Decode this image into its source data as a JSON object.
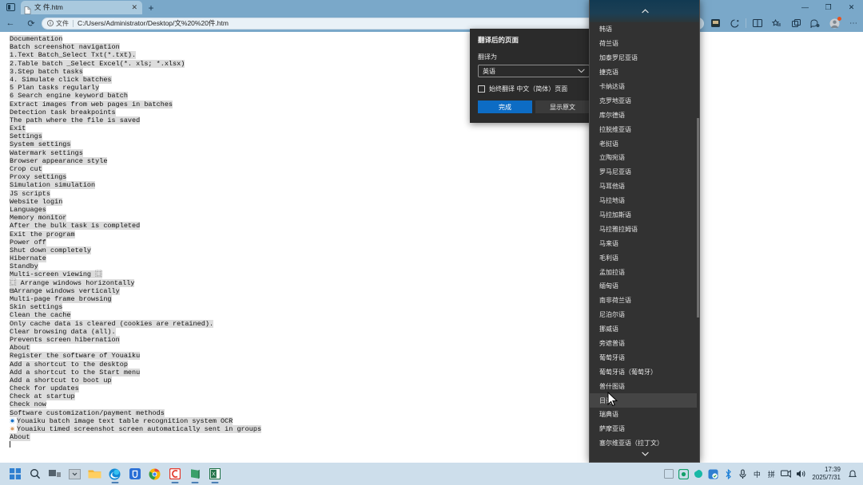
{
  "browser": {
    "tab": {
      "title": "文 件.htm",
      "close_label": "✕",
      "favicon": "page-icon"
    },
    "new_tab_label": "+",
    "window_controls": {
      "minimize": "—",
      "maximize": "❐",
      "close": "✕"
    },
    "nav": {
      "back": "←",
      "reload": "⟳"
    },
    "omnibox": {
      "info_icon": "info-icon",
      "scheme_label": "文件",
      "url": "C:/Users/Administrator/Desktop/文%20%20件.htm"
    },
    "toolbar_icons": [
      "read-aloud-icon",
      "translate-pill-icon",
      "split-screen-icon",
      "browser-essentials-icon",
      "collections-icon",
      "favorites-icon",
      "split-tab-icon",
      "copilot-icon",
      "profile-avatar",
      "settings-more-icon"
    ]
  },
  "document": {
    "lines": [
      "Documentation",
      "Batch screenshot navigation",
      "1.Text Batch_Select Txt(*.txt).",
      "2.Table batch _Select Excel(*. xls; *.xlsx)",
      "3.Step batch tasks",
      "4. Simulate click batches",
      "5 Plan tasks regularly",
      "6 Search engine keyword batch",
      "Extract images from web pages in batches",
      "Detection task breakpoints",
      "The path where the file is saved",
      "Exit",
      "Settings",
      "System settings",
      "Watermark settings",
      "Browser appearance style",
      "Crop cut",
      "Proxy settings",
      "Simulation simulation",
      "JS scripts",
      "Website login",
      "Languages",
      "Memory monitor",
      "After the bulk task is completed",
      "Exit the program",
      "Power off",
      "Shut down completely",
      "Hibernate",
      "Standby",
      "Multi-screen viewing ⿴",
      "⿴ Arrange windows horizontally",
      "⊟Arrange windows vertically",
      "Multi-page frame browsing",
      "Skin settings",
      "Clean the cache",
      "Only cache data is cleared (cookies are retained).",
      "Clear browsing data (all).",
      "Prevents screen hibernation",
      "About",
      "Register the software of Youaiku",
      "Add a shortcut to the desktop",
      "Add a shortcut to the Start menu",
      "Add a shortcut to boot up",
      "Check for updates",
      "Check at startup",
      "Check now",
      "Software customization/payment methods"
    ],
    "icon_lines": [
      {
        "icon": "radio-blue-icon",
        "text": "Youaiku batch image text table recognition system OCR"
      },
      {
        "icon": "radio-tan-icon",
        "text": "Youaiku timed screenshot screen automatically sent in groups"
      }
    ],
    "last_line": "About"
  },
  "translate_dialog": {
    "title": "翻译后的页面",
    "subtitle": "翻译为",
    "selected_language": "英语",
    "dropdown_icon": "chevron-down-icon",
    "always_translate_label": "始终翻译 中文（简体）页面",
    "done_button": "完成",
    "show_original_button": "显示原文"
  },
  "language_menu": {
    "scroll_up_icon": "scroll-up-arrow",
    "scroll_down_icon": "scroll-down-arrow",
    "selected": "日语",
    "items": [
      "韩语",
      "荷兰语",
      "加泰罗尼亚语",
      "捷克语",
      "卡纳达语",
      "克罗地亚语",
      "库尔德语",
      "拉脱维亚语",
      "老挝语",
      "立陶宛语",
      "罗马尼亚语",
      "马耳他语",
      "马拉地语",
      "马拉加斯语",
      "马拉雅拉姆语",
      "马来语",
      "毛利语",
      "孟加拉语",
      "缅甸语",
      "南非荷兰语",
      "尼泊尔语",
      "挪威语",
      "旁遮普语",
      "葡萄牙语",
      "葡萄牙语（葡萄牙）",
      "普什图语",
      "日语",
      "瑞典语",
      "萨摩亚语",
      "塞尔维亚语（拉丁文）"
    ]
  },
  "taskbar": {
    "left_items": [
      "start-icon",
      "search-icon",
      "task-view-icon",
      "widgets-icon",
      "file-explorer-icon",
      "edge-icon",
      "app-blue-icon",
      "chrome-icon",
      "app-red-c-icon",
      "app-green-book-icon",
      "excel-icon"
    ],
    "right_items": [
      "show-desktop-icon",
      "app-tray-green-icon",
      "app-tray-teal-icon",
      "app-tray-blue-icon",
      "bluetooth-icon",
      "microphone-icon"
    ],
    "ime_mode": "中",
    "ime_pinyin": "拼",
    "network_icon": "network-icon",
    "volume_icon": "volume-icon",
    "time": "17:39",
    "date": "2025/7/31",
    "notification_icon": "notification-bell-icon"
  },
  "colors": {
    "browser_chrome": "#7aa8c9",
    "tab_active": "#a9c9de",
    "dialog_bg": "#2b2b2b",
    "primary_button": "#0d6cc4",
    "menu_bg": "#323232",
    "menu_selected": "#454545",
    "taskbar_bg": "#cddeeb",
    "highlight": "#dcdcdc"
  }
}
